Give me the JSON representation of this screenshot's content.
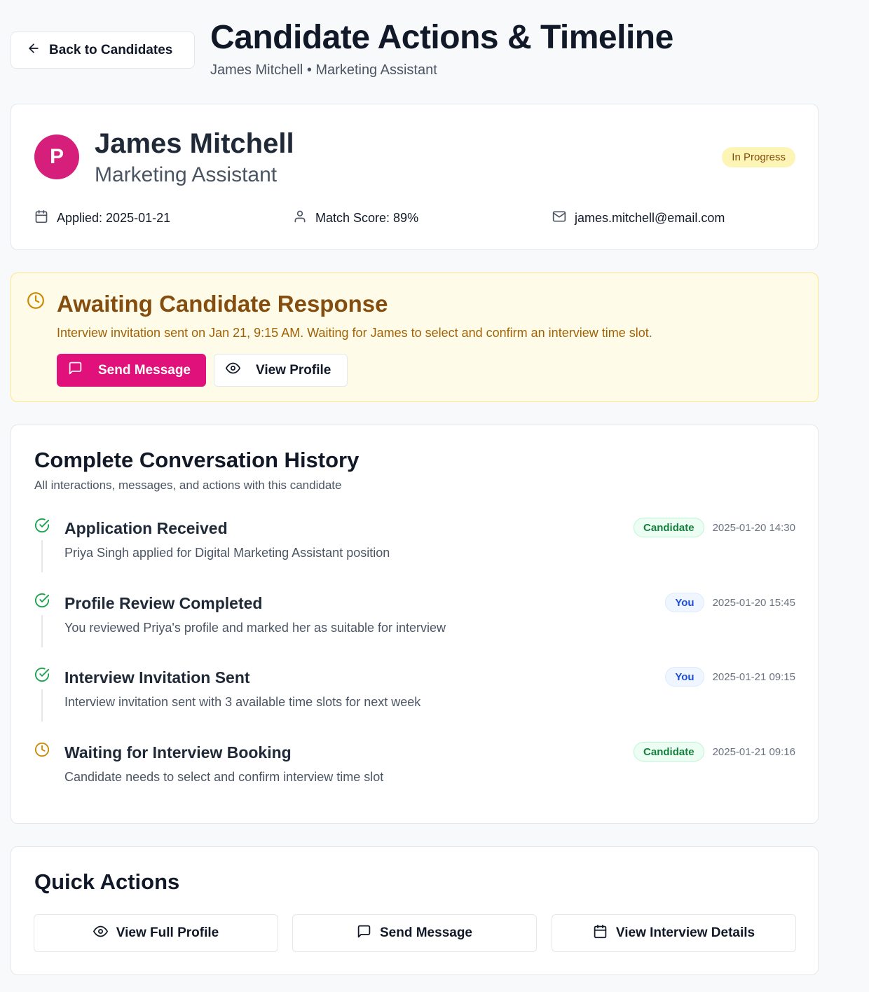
{
  "header": {
    "back_label": "Back to Candidates",
    "title": "Candidate Actions & Timeline",
    "subtitle": "James Mitchell • Marketing Assistant"
  },
  "profile": {
    "avatar_initial": "P",
    "name": "James Mitchell",
    "role": "Marketing Assistant",
    "status": "In Progress",
    "applied": "Applied: 2025-01-21",
    "match_score": "Match Score: 89%",
    "email": "james.mitchell@email.com"
  },
  "alert": {
    "title": "Awaiting Candidate Response",
    "text": "Interview invitation sent on Jan 21, 9:15 AM. Waiting for James to select and confirm an interview time slot.",
    "send_message_label": "Send Message",
    "view_profile_label": "View Profile"
  },
  "history": {
    "title": "Complete Conversation History",
    "subtitle": "All interactions, messages, and actions with this candidate",
    "items": [
      {
        "title": "Application Received",
        "description": "Priya Singh applied for Digital Marketing Assistant position",
        "actor": "Candidate",
        "timestamp": "2025-01-20 14:30",
        "status_icon": "check-circle-icon"
      },
      {
        "title": "Profile Review Completed",
        "description": "You reviewed Priya's profile and marked her as suitable for interview",
        "actor": "You",
        "timestamp": "2025-01-20 15:45",
        "status_icon": "check-circle-icon"
      },
      {
        "title": "Interview Invitation Sent",
        "description": "Interview invitation sent with 3 available time slots for next week",
        "actor": "You",
        "timestamp": "2025-01-21 09:15",
        "status_icon": "check-circle-icon"
      },
      {
        "title": "Waiting for Interview Booking",
        "description": "Candidate needs to select and confirm interview time slot",
        "actor": "Candidate",
        "timestamp": "2025-01-21 09:16",
        "status_icon": "clock-icon"
      }
    ]
  },
  "quick_actions": {
    "title": "Quick Actions",
    "view_full_profile": "View Full Profile",
    "send_message": "Send Message",
    "view_interview_details": "View Interview Details"
  },
  "colors": {
    "brand_pink": "#e0117a",
    "avatar_pink": "#d61f7a",
    "warning_text": "#854d0e",
    "success_green": "#16a34a",
    "pending_amber": "#ca8a04"
  }
}
